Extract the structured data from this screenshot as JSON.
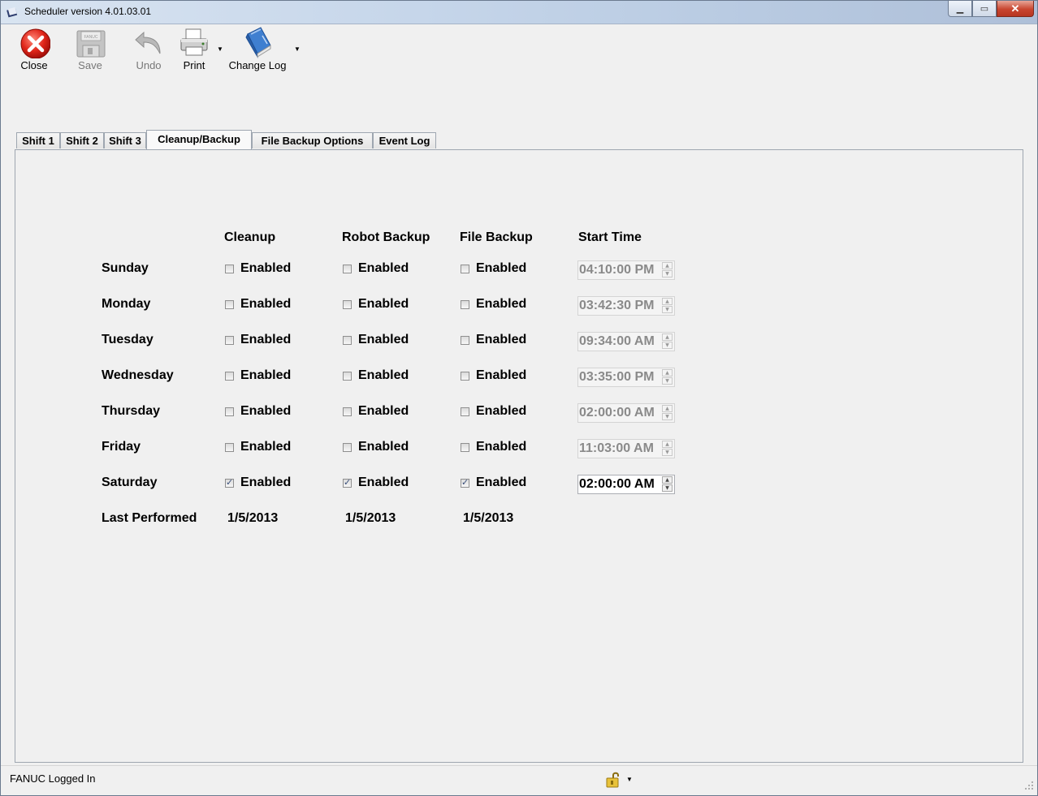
{
  "window": {
    "title": "Scheduler  version  4.01.03.01"
  },
  "toolbar": {
    "close": "Close",
    "save": "Save",
    "undo": "Undo",
    "print": "Print",
    "change_log": "Change Log",
    "save_disk_text": "FANUC"
  },
  "tabs": [
    "Shift 1",
    "Shift 2",
    "Shift 3",
    "Cleanup/Backup",
    "File Backup Options",
    "Event Log"
  ],
  "active_tab": "Cleanup/Backup",
  "columns": {
    "cleanup": "Cleanup",
    "robot_backup": "Robot Backup",
    "file_backup": "File Backup",
    "start_time": "Start Time"
  },
  "enabled_label": "Enabled",
  "days": [
    {
      "name": "Sunday",
      "cleanup": false,
      "robot": false,
      "file": false,
      "time": "04:10:00 PM",
      "active": false
    },
    {
      "name": "Monday",
      "cleanup": false,
      "robot": false,
      "file": false,
      "time": "03:42:30 PM",
      "active": false
    },
    {
      "name": "Tuesday",
      "cleanup": false,
      "robot": false,
      "file": false,
      "time": "09:34:00 AM",
      "active": false
    },
    {
      "name": "Wednesday",
      "cleanup": false,
      "robot": false,
      "file": false,
      "time": "03:35:00 PM",
      "active": false
    },
    {
      "name": "Thursday",
      "cleanup": false,
      "robot": false,
      "file": false,
      "time": "02:00:00 AM",
      "active": false
    },
    {
      "name": "Friday",
      "cleanup": false,
      "robot": false,
      "file": false,
      "time": "11:03:00 AM",
      "active": false
    },
    {
      "name": "Saturday",
      "cleanup": true,
      "robot": true,
      "file": true,
      "time": "02:00:00 AM",
      "active": true
    }
  ],
  "last_performed": {
    "label": "Last Performed",
    "cleanup": "1/5/2013",
    "robot_backup": "1/5/2013",
    "file_backup": "1/5/2013"
  },
  "status": {
    "text": "FANUC Logged In"
  },
  "icons": {
    "close": "close-icon",
    "save": "save-icon",
    "undo": "undo-icon",
    "print": "printer-icon",
    "change_log": "book-icon",
    "lock": "lock-icon"
  },
  "colors": {
    "accent": "#d62a1e",
    "panel_bg": "#f0f0f0"
  }
}
